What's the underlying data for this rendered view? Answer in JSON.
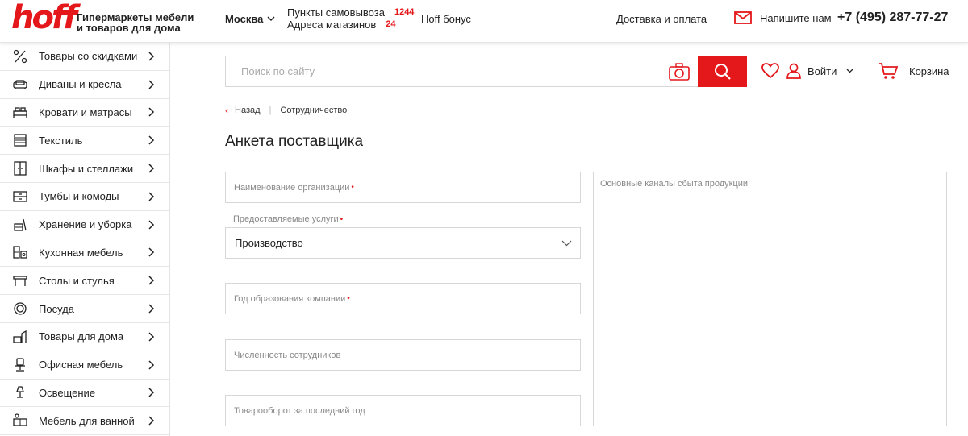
{
  "header": {
    "logo": "hoff",
    "logo_line1": "Гипермаркеты мебели",
    "logo_line2": "и товаров для дома",
    "city": "Москва",
    "pickup_label": "Пункты самовывоза",
    "pickup_count": "1244",
    "stores_label": "Адреса магазинов",
    "stores_count": "24",
    "bonus": "Hoff бонус",
    "delivery": "Доставка и оплата",
    "write_us": "Напишите нам",
    "phone": "+7 (495) 287-77-27"
  },
  "sidebar": {
    "items": [
      {
        "label": "Товары со скидками",
        "icon": "percent-icon"
      },
      {
        "label": "Диваны и кресла",
        "icon": "sofa-icon"
      },
      {
        "label": "Кровати и матрасы",
        "icon": "bed-icon"
      },
      {
        "label": "Текстиль",
        "icon": "textile-icon"
      },
      {
        "label": "Шкафы и стеллажи",
        "icon": "wardrobe-icon"
      },
      {
        "label": "Тумбы и комоды",
        "icon": "dresser-icon"
      },
      {
        "label": "Хранение и уборка",
        "icon": "storage-icon"
      },
      {
        "label": "Кухонная мебель",
        "icon": "kitchen-icon"
      },
      {
        "label": "Столы и стулья",
        "icon": "table-icon"
      },
      {
        "label": "Посуда",
        "icon": "dishes-icon"
      },
      {
        "label": "Товары для дома",
        "icon": "home-goods-icon"
      },
      {
        "label": "Офисная мебель",
        "icon": "office-chair-icon"
      },
      {
        "label": "Освещение",
        "icon": "lamp-icon"
      },
      {
        "label": "Мебель для ванной",
        "icon": "bathroom-icon"
      }
    ]
  },
  "search": {
    "placeholder": "Поиск по сайту"
  },
  "account": {
    "login": "Войти",
    "cart": "Корзина"
  },
  "breadcrumb": {
    "back": "Назад",
    "current": "Сотрудничество"
  },
  "page": {
    "title": "Анкета поставщика"
  },
  "form": {
    "org_name": "Наименование организации",
    "services_label": "Предоставляемые услуги",
    "services_value": "Производство",
    "founded": "Год образования компании",
    "employees": "Численность сотрудников",
    "turnover": "Товарооборот за последний год",
    "channels": "Основные каналы сбыта продукции",
    "required_mark": "•"
  },
  "colors": {
    "brand": "#e4171b",
    "border": "#d7d7d7"
  }
}
